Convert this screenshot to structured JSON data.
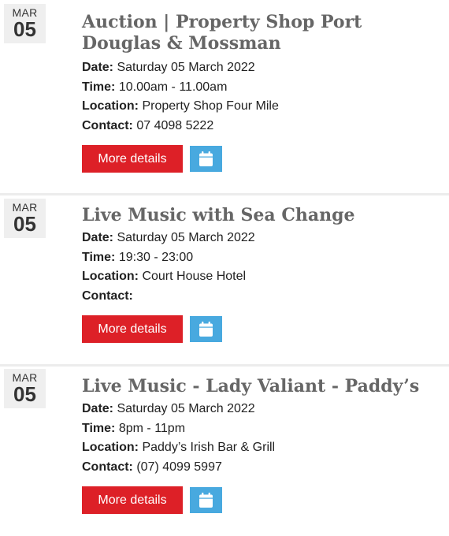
{
  "events": [
    {
      "month": "MAR",
      "day": "05",
      "title": "Auction | Property Shop Port Douglas & Mossman",
      "date_label": "Date:",
      "date_value": "Saturday 05 March 2022",
      "time_label": "Time:",
      "time_value": "10.00am - 11.00am",
      "location_label": "Location:",
      "location_value": "Property Shop Four Mile",
      "contact_label": "Contact:",
      "contact_value": "07 4098 5222",
      "more_label": "More details",
      "calendar_icon": "calendar-icon"
    },
    {
      "month": "MAR",
      "day": "05",
      "title": "Live Music with Sea Change",
      "date_label": "Date:",
      "date_value": "Saturday 05 March 2022",
      "time_label": "Time:",
      "time_value": "19:30 - 23:00",
      "location_label": "Location:",
      "location_value": "Court House Hotel",
      "contact_label": "Contact:",
      "contact_value": "",
      "more_label": "More details",
      "calendar_icon": "calendar-icon"
    },
    {
      "month": "MAR",
      "day": "05",
      "title": "Live Music - Lady Valiant - Paddy’s",
      "date_label": "Date:",
      "date_value": "Saturday 05 March 2022",
      "time_label": "Time:",
      "time_value": "8pm - 11pm",
      "location_label": "Location:",
      "location_value": "Paddy’s Irish Bar & Grill",
      "contact_label": "Contact:",
      "contact_value": "(07) 4099 5997",
      "more_label": "More details",
      "calendar_icon": "calendar-icon"
    }
  ],
  "colors": {
    "more_button_bg": "#dd2027",
    "calendar_button_bg": "#48a9df",
    "title_text": "#666666",
    "date_box_bg": "#efefef"
  }
}
